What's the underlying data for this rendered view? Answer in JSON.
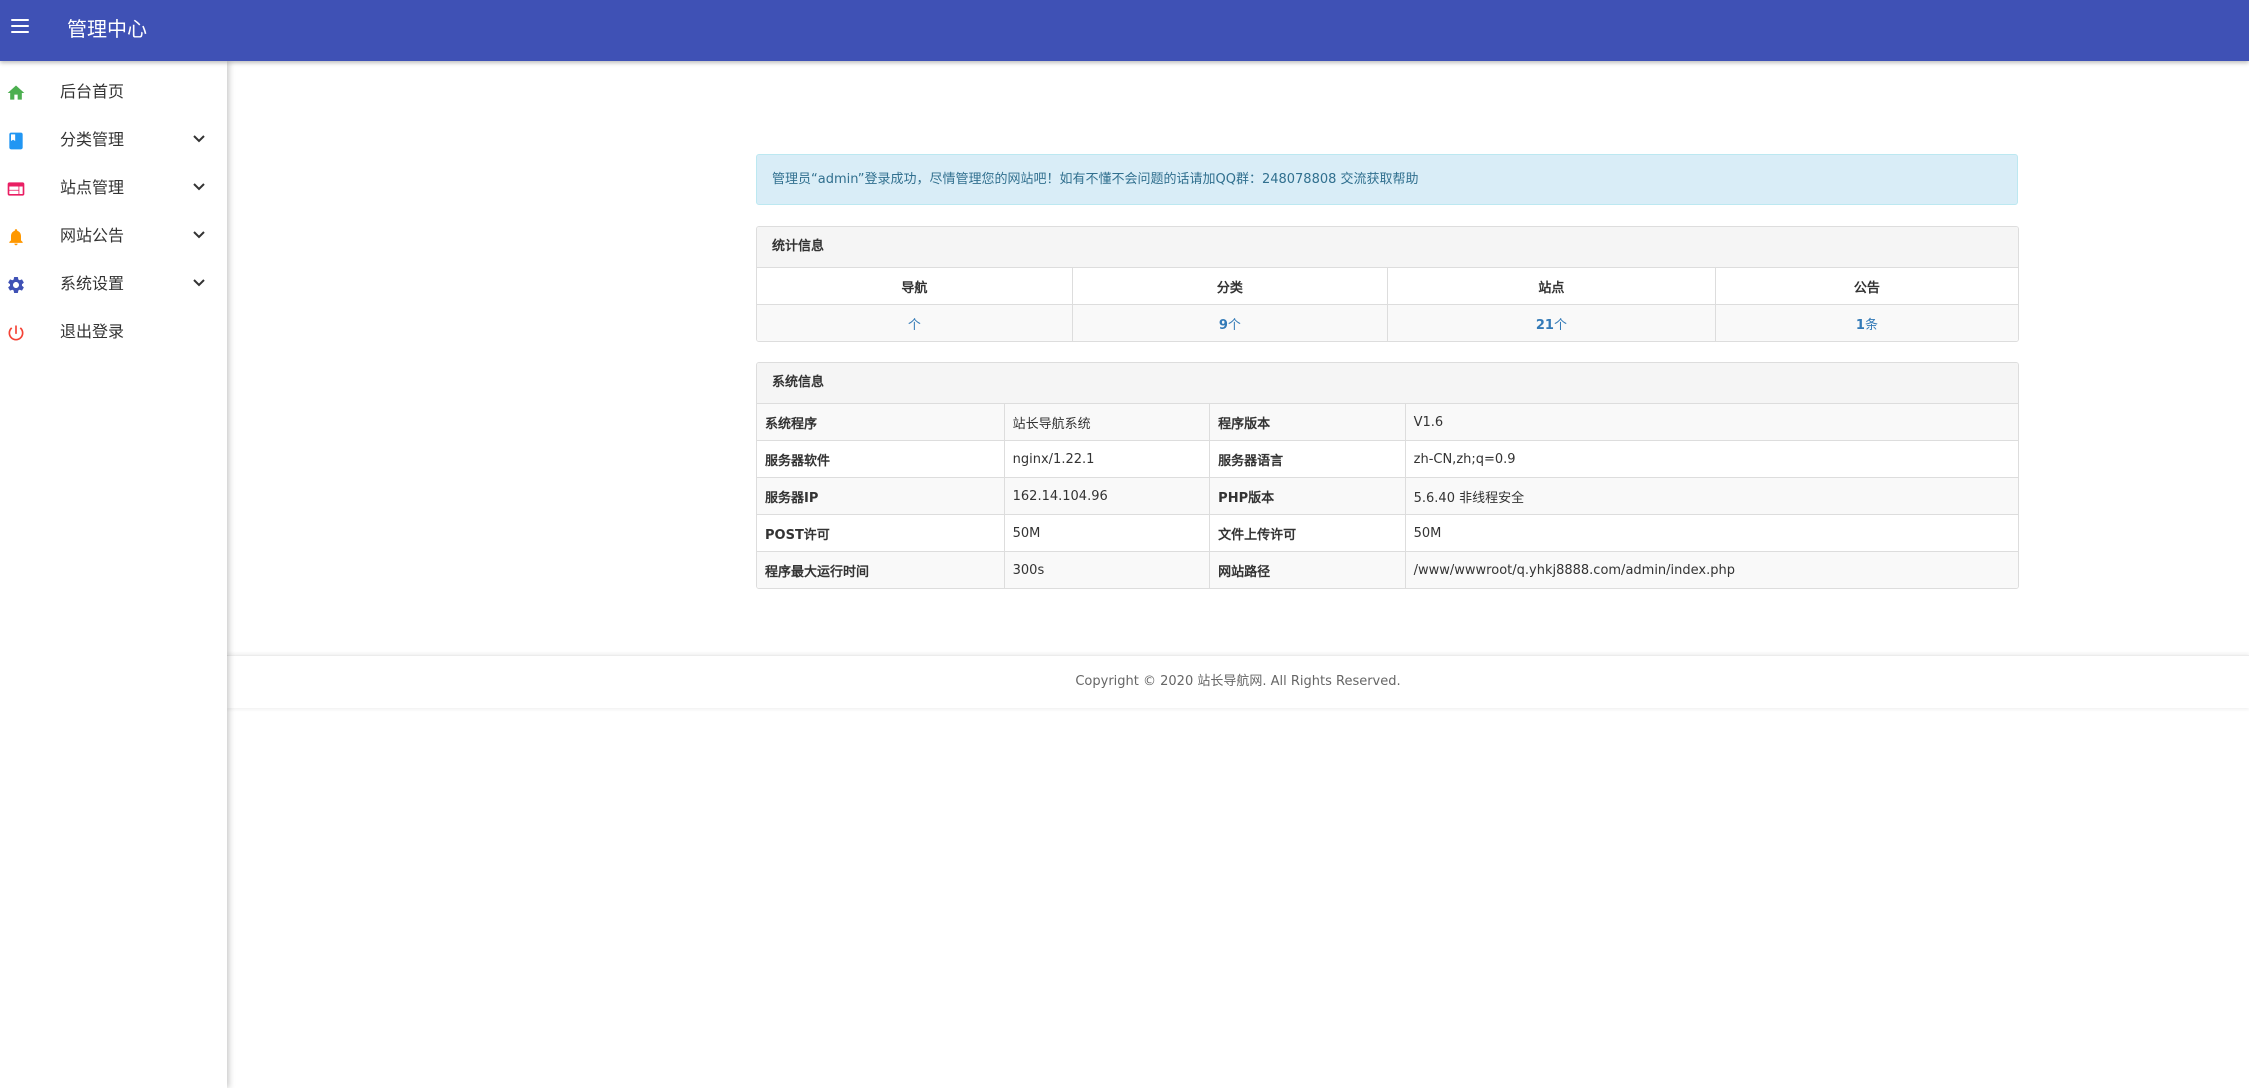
{
  "appbar": {
    "title": "管理中心",
    "menu_icon": "menu-icon",
    "color": "#3f51b5"
  },
  "sidebar": {
    "items": [
      {
        "label": "后台首页",
        "icon": "home-icon",
        "icon_color": "#4caf50",
        "expandable": false
      },
      {
        "label": "分类管理",
        "icon": "book-icon",
        "icon_color": "#2196f3",
        "expandable": true
      },
      {
        "label": "站点管理",
        "icon": "web-icon",
        "icon_color": "#e91e63",
        "expandable": true
      },
      {
        "label": "网站公告",
        "icon": "bell-icon",
        "icon_color": "#ff9800",
        "expandable": true
      },
      {
        "label": "系统设置",
        "icon": "gear-icon",
        "icon_color": "#3f51b5",
        "expandable": true
      },
      {
        "label": "退出登录",
        "icon": "power-icon",
        "icon_color": "#f44336",
        "expandable": false
      }
    ]
  },
  "alert": {
    "message": "管理员“admin”登录成功，尽情管理您的网站吧！如有不懂不会问题的话请加QQ群：248078808 交流获取帮助"
  },
  "stats": {
    "title": "统计信息",
    "columns": [
      {
        "label": "导航",
        "value": "",
        "unit": "个"
      },
      {
        "label": "分类",
        "value": "9",
        "unit": "个"
      },
      {
        "label": "站点",
        "value": "21",
        "unit": "个"
      },
      {
        "label": "公告",
        "value": "1",
        "unit": "条"
      }
    ]
  },
  "system": {
    "title": "系统信息",
    "rows": [
      {
        "k1": "系统程序",
        "v1": "站长导航系统",
        "k2": "程序版本",
        "v2": "V1.6"
      },
      {
        "k1": "服务器软件",
        "v1": "nginx/1.22.1",
        "k2": "服务器语言",
        "v2": "zh-CN,zh;q=0.9"
      },
      {
        "k1": "服务器IP",
        "v1": "162.14.104.96",
        "k2": "PHP版本",
        "v2": "5.6.40 非线程安全"
      },
      {
        "k1": "POST许可",
        "v1": "50M",
        "k2": "文件上传许可",
        "v2": "50M"
      },
      {
        "k1": "程序最大运行时间",
        "v1": "300s",
        "k2": "网站路径",
        "v2": "/www/wwwroot/q.yhkj8888.com/admin/index.php"
      }
    ]
  },
  "footer": {
    "copyright": "Copyright © 2020 站长导航网. All Rights Reserved."
  }
}
